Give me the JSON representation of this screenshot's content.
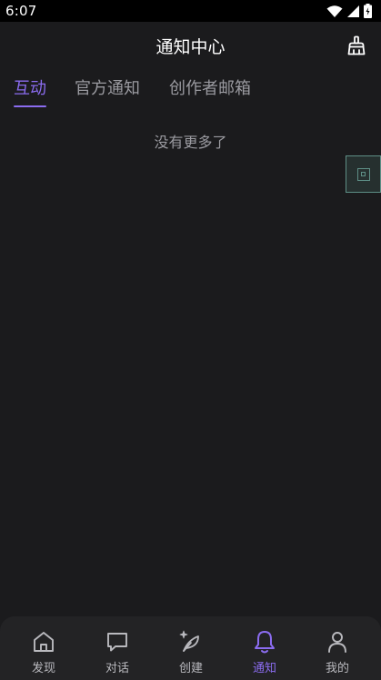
{
  "status_bar": {
    "time": "6:07",
    "icons": [
      "wifi-icon",
      "signal-icon",
      "battery-icon"
    ]
  },
  "header": {
    "title": "通知中心",
    "action_icon": "broom-icon"
  },
  "tabs": [
    {
      "label": "互动",
      "active": true
    },
    {
      "label": "官方通知",
      "active": false
    },
    {
      "label": "创作者邮箱",
      "active": false
    }
  ],
  "empty_state": {
    "text": "没有更多了"
  },
  "bottom_nav": [
    {
      "label": "发现",
      "icon": "home-icon",
      "active": false
    },
    {
      "label": "对话",
      "icon": "chat-icon",
      "active": false
    },
    {
      "label": "创建",
      "icon": "feather-icon",
      "active": false
    },
    {
      "label": "通知",
      "icon": "bell-icon",
      "active": true
    },
    {
      "label": "我的",
      "icon": "person-icon",
      "active": false
    }
  ],
  "colors": {
    "accent": "#8b6cf0",
    "background": "#1b1b1d",
    "nav_background": "#232325",
    "inactive_text": "#9a9aa0"
  }
}
